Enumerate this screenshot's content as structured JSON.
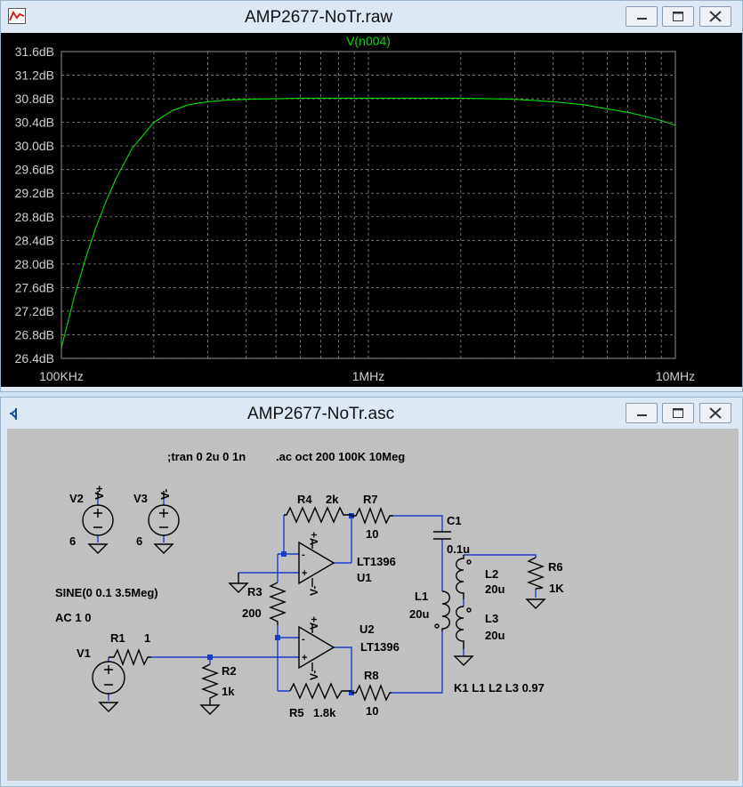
{
  "plot_window": {
    "title": "AMP2677-NoTr.raw",
    "trace_name": "V(n004)",
    "y_ticks": [
      "31.6dB",
      "31.2dB",
      "30.8dB",
      "30.4dB",
      "30.0dB",
      "29.6dB",
      "29.2dB",
      "28.8dB",
      "28.4dB",
      "28.0dB",
      "27.6dB",
      "27.2dB",
      "26.8dB",
      "26.4dB"
    ],
    "x_ticks": [
      "100KHz",
      "1MHz",
      "10MHz"
    ]
  },
  "schematic_window": {
    "title": "AMP2677-NoTr.asc",
    "directives": {
      "tran": ";tran 0 2u 0 1n",
      "ac": ".ac oct 200 100K 10Meg"
    },
    "labels": {
      "v2": "V2",
      "v2_val": "6",
      "v3": "V3",
      "v3_val": "6",
      "vplus": "V+",
      "vminus": "V-",
      "r4": "R4",
      "r4_val": "2k",
      "r7": "R7",
      "r7_val": "10",
      "c1": "C1",
      "c1_val": "0.1u",
      "r6": "R6",
      "r6_val": "1K",
      "u1_part": "LT1396",
      "u1": "U1",
      "r3": "R3",
      "r3_val": "200",
      "u2": "U2",
      "u2_part": "LT1396",
      "l1": "L1",
      "l1_val": "20u",
      "l2": "L2",
      "l2_val": "20u",
      "l3": "L3",
      "l3_val": "20u",
      "sine": "SINE(0 0.1 3.5Meg)",
      "ac_src": "AC 1 0",
      "v1": "V1",
      "r1": "R1",
      "r1_val": "1",
      "r2": "R2",
      "r2_val": "1k",
      "r8": "R8",
      "r8_val": "10",
      "r5": "R5",
      "r5_val": "1.8k",
      "k1": "K1 L1 L2 L3 0.97",
      "oa1_vp": "V+",
      "oa1_vm": "V-",
      "oa2_vp": "V+",
      "oa2_vm": "V-",
      "plus": "+",
      "minus": "-"
    }
  },
  "colors": {
    "trace": "#00e000",
    "grid": "#8a8a8a",
    "wire": "#1a3dc8",
    "component": "#000000"
  },
  "chart_data": {
    "type": "line",
    "title": "",
    "xlabel": "",
    "ylabel": "",
    "xscale": "log",
    "xlim": [
      100000,
      10000000
    ],
    "ylim": [
      26.4,
      31.6
    ],
    "grid": true,
    "series": [
      {
        "name": "V(n004)",
        "x": [
          100000,
          110000,
          120000,
          130000,
          140000,
          150000,
          170000,
          200000,
          230000,
          260000,
          300000,
          350000,
          400000,
          500000,
          600000,
          800000,
          1000000,
          1500000,
          2000000,
          2500000,
          3000000,
          3500000,
          4000000,
          5000000,
          6000000,
          7000000,
          8000000,
          9000000,
          10000000
        ],
        "y": [
          26.58,
          27.43,
          28.1,
          28.64,
          29.07,
          29.43,
          29.96,
          30.4,
          30.6,
          30.7,
          30.75,
          30.78,
          30.79,
          30.8,
          30.81,
          30.81,
          30.81,
          30.81,
          30.81,
          30.8,
          30.79,
          30.77,
          30.75,
          30.7,
          30.63,
          30.57,
          30.5,
          30.43,
          30.35
        ]
      }
    ]
  }
}
